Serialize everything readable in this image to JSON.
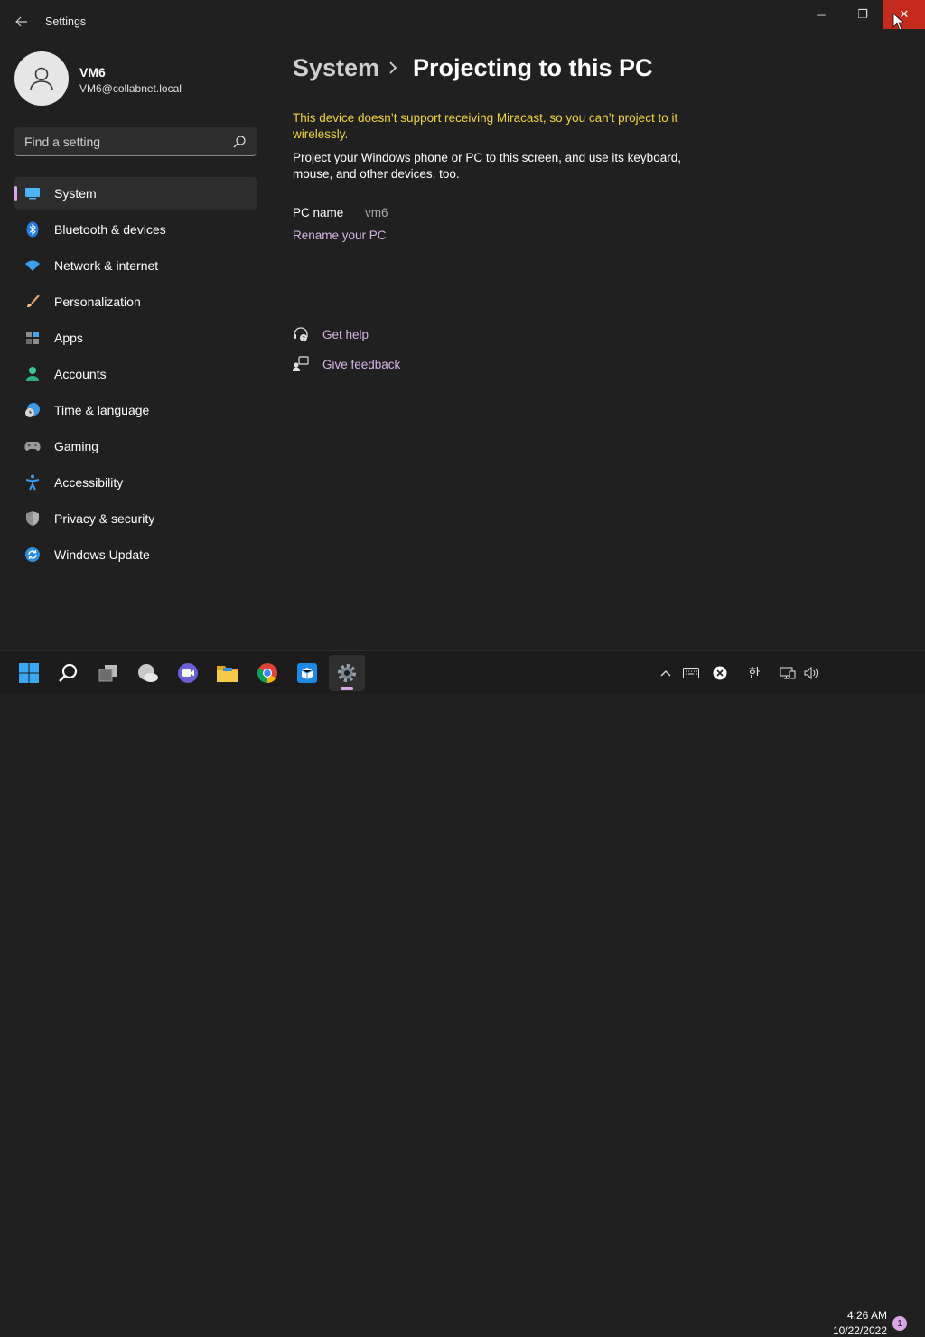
{
  "window": {
    "title": "Settings",
    "back_icon": "back-arrow-icon",
    "controls": {
      "minimize": "─",
      "maximize": "❐",
      "close": "✕"
    }
  },
  "account": {
    "name": "VM6",
    "email": "VM6@collabnet.local"
  },
  "search": {
    "placeholder": "Find a setting",
    "value": ""
  },
  "nav": {
    "items": [
      {
        "label": "System",
        "icon": "system-icon",
        "active": true
      },
      {
        "label": "Bluetooth & devices",
        "icon": "bluetooth-icon"
      },
      {
        "label": "Network & internet",
        "icon": "wifi-icon"
      },
      {
        "label": "Personalization",
        "icon": "brush-icon"
      },
      {
        "label": "Apps",
        "icon": "apps-icon"
      },
      {
        "label": "Accounts",
        "icon": "accounts-icon"
      },
      {
        "label": "Time & language",
        "icon": "time-language-icon"
      },
      {
        "label": "Gaming",
        "icon": "gaming-icon"
      },
      {
        "label": "Accessibility",
        "icon": "accessibility-icon"
      },
      {
        "label": "Privacy & security",
        "icon": "shield-icon"
      },
      {
        "label": "Windows Update",
        "icon": "windows-update-icon"
      }
    ]
  },
  "content": {
    "breadcrumb_root": "System",
    "breadcrumb_current": "Projecting to this PC",
    "warning": "This device doesn’t support receiving Miracast, so you can’t project to it wirelessly.",
    "description": "Project your Windows phone or PC to this screen, and use its keyboard, mouse, and other devices, too.",
    "pc_name_label": "PC name",
    "pc_name_value": "vm6",
    "rename_link": "Rename your PC",
    "get_help": "Get help",
    "give_feedback": "Give feedback"
  },
  "taskbar": {
    "tray_language": "한",
    "time": "4:26 AM",
    "date": "10/22/2022",
    "notification_count": "1"
  },
  "colors": {
    "accent": "#d9a5e6",
    "link": "#d6b4e6",
    "warning": "#f2d53c",
    "close_hover": "#c42b1c",
    "background": "#202020"
  }
}
